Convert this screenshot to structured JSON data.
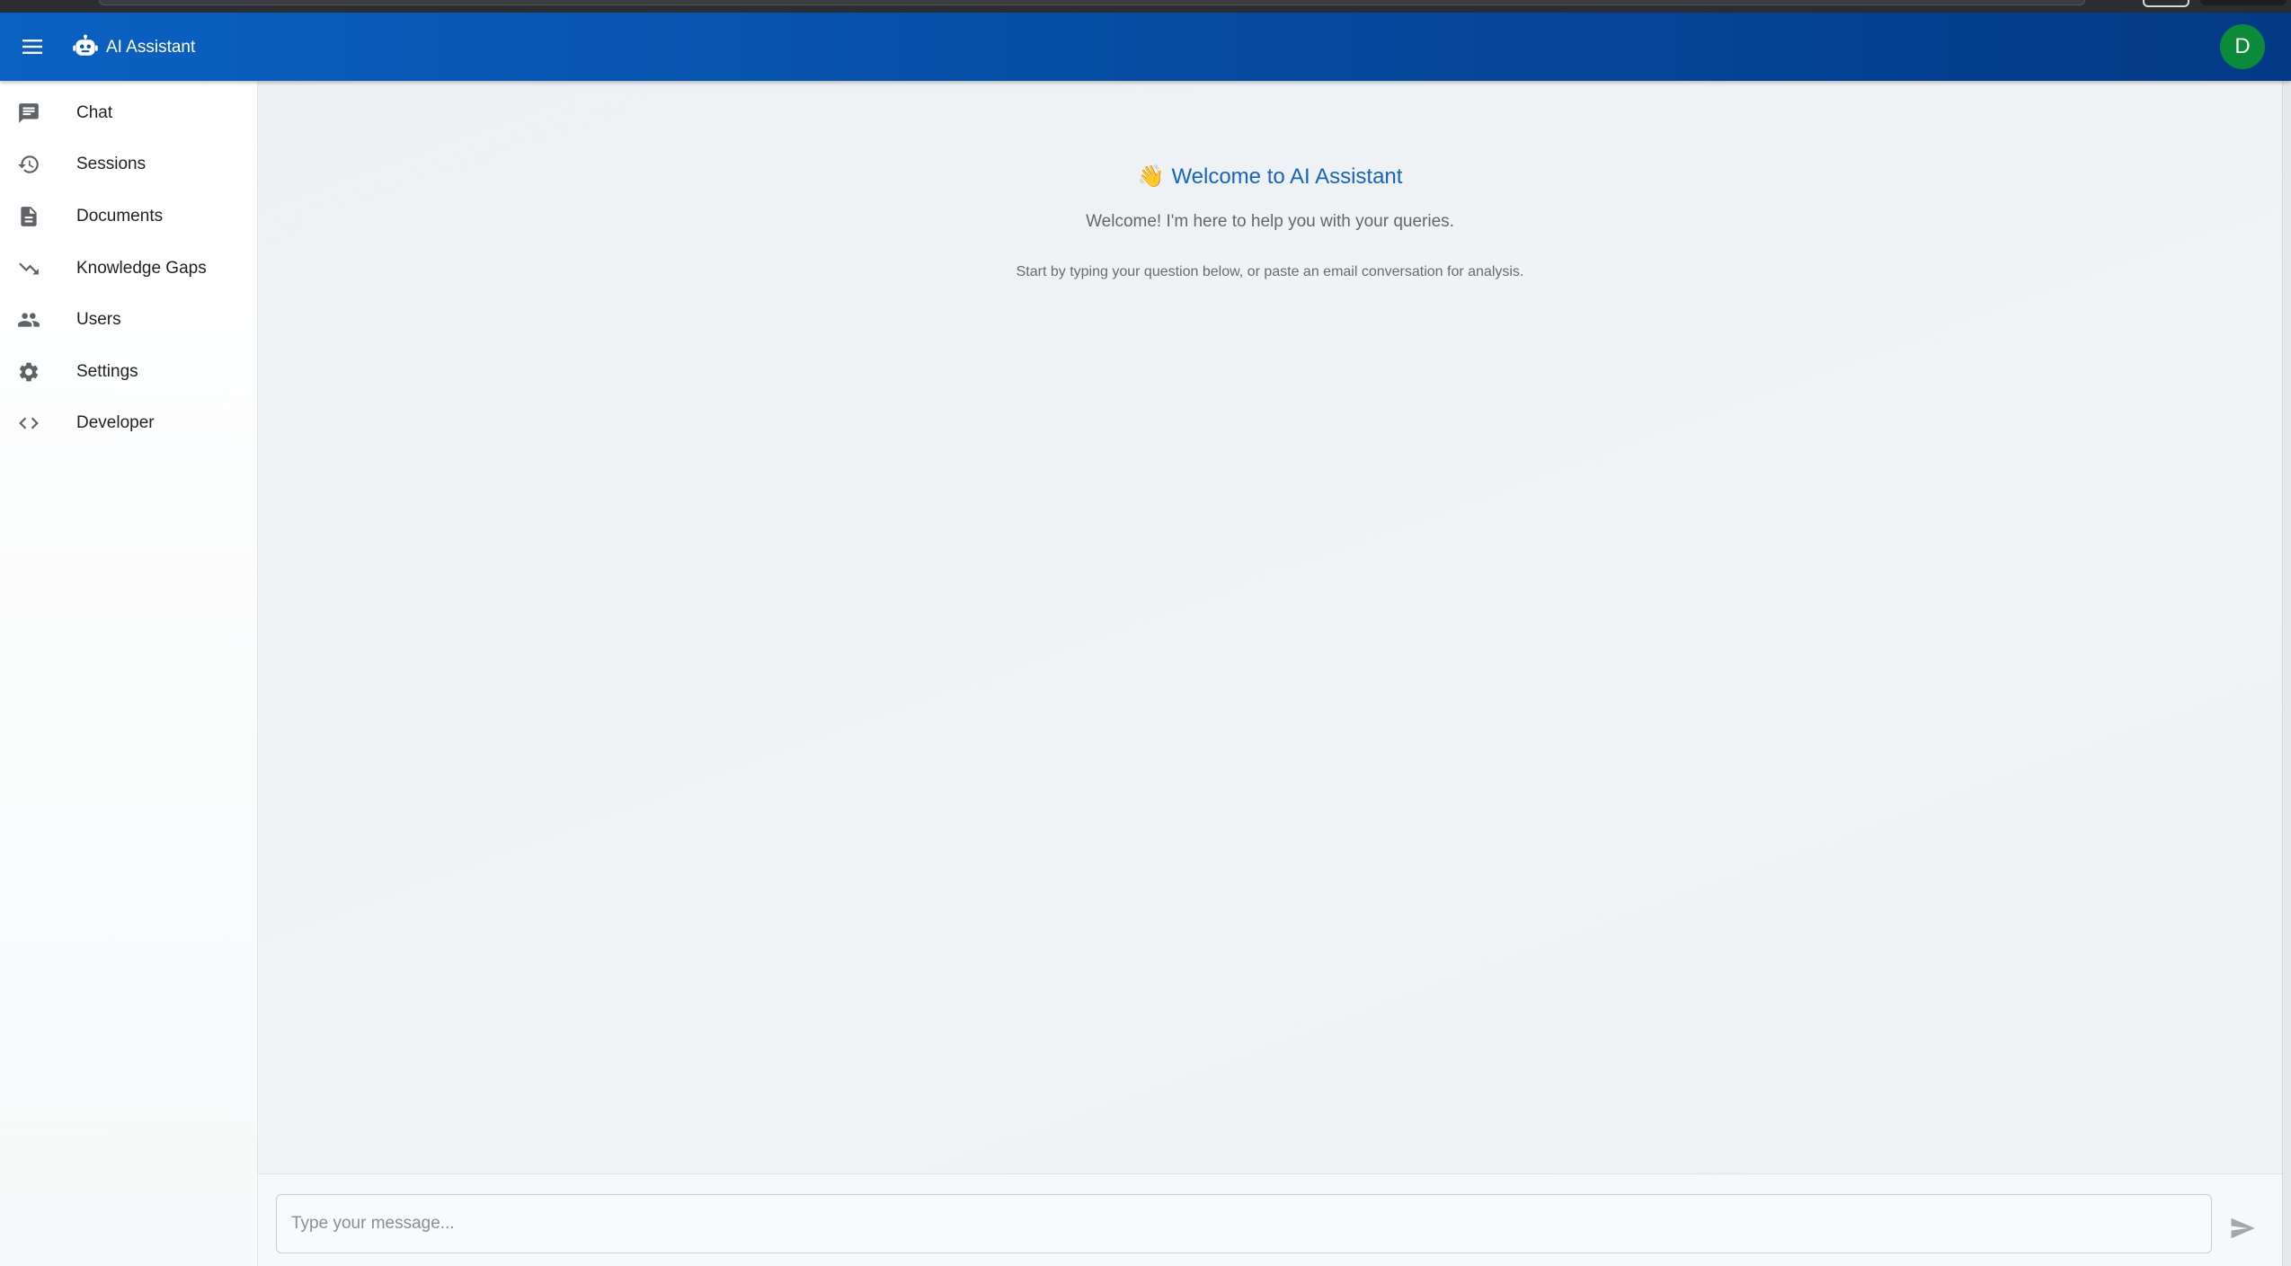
{
  "app": {
    "title": "AI Assistant",
    "user_initial": "D"
  },
  "sidebar": {
    "items": [
      {
        "label": "Chat",
        "icon": "chat-icon"
      },
      {
        "label": "Sessions",
        "icon": "history-icon"
      },
      {
        "label": "Documents",
        "icon": "document-icon"
      },
      {
        "label": "Knowledge Gaps",
        "icon": "trending-down-icon"
      },
      {
        "label": "Users",
        "icon": "users-icon"
      },
      {
        "label": "Settings",
        "icon": "gear-icon"
      },
      {
        "label": "Developer",
        "icon": "code-icon"
      }
    ]
  },
  "main": {
    "welcome_emoji": "👋",
    "welcome_title": "Welcome to AI Assistant",
    "welcome_subtitle": "Welcome! I'm here to help you with your queries.",
    "welcome_hint": "Start by typing your question below, or paste an email conversation for analysis."
  },
  "composer": {
    "placeholder": "Type your message...",
    "value": ""
  },
  "colors": {
    "appbar_start": "#0a61c2",
    "appbar_end": "#033a86",
    "avatar": "#0b8a3a",
    "title_accent": "#1565c0"
  }
}
